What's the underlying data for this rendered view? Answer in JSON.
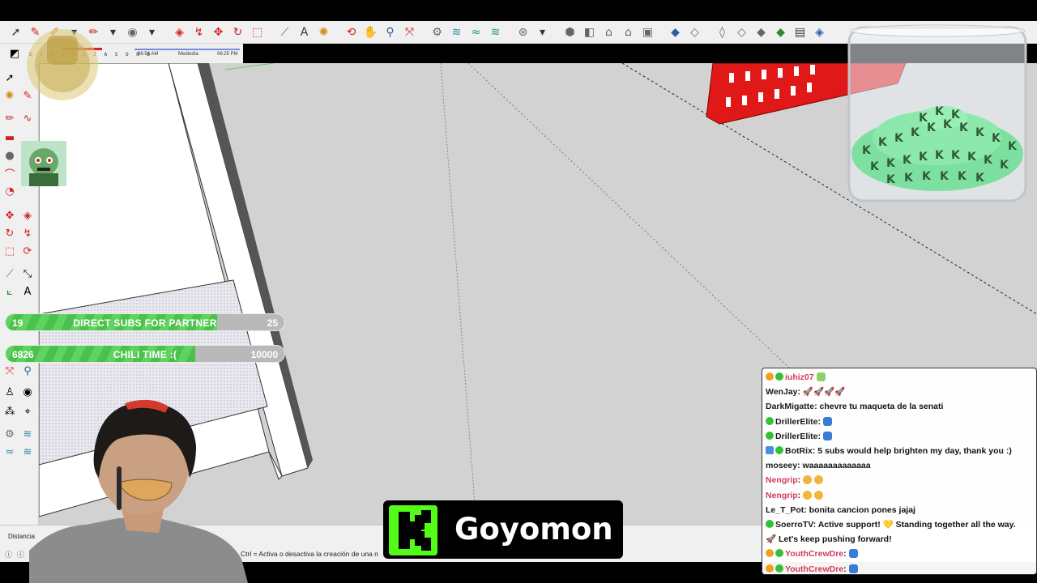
{
  "toolbar": {
    "icons": [
      "select-arrow-icon",
      "eraser-icon",
      "paint-icon",
      "dropdown-icon",
      "circle-icon",
      "dropdown-icon",
      "move-blue-icon",
      "followme-icon",
      "move-icon",
      "rotate-icon",
      "scale-icon",
      "tape-icon",
      "text-icon",
      "paint-bucket-icon",
      "orbit-icon",
      "pan-icon",
      "zoom-icon",
      "zoom-extents-icon",
      "section-icon",
      "section2-icon",
      "section3-icon",
      "section4-icon",
      "settings-icon",
      "dropdown-icon",
      "component-icon",
      "component2-icon",
      "house-icon",
      "house2-icon",
      "house3-icon",
      "box-icon",
      "box2-icon",
      "view1-icon",
      "view2-icon",
      "view3-icon",
      "view4-icon",
      "view5-icon",
      "view6-icon"
    ]
  },
  "shadow_bar": {
    "months": "E F M A M J J A S O N D",
    "time_start": "06:54 AM",
    "midday": "Mediodía",
    "time_end": "06:25 PM"
  },
  "goals": [
    {
      "current": "19",
      "title": "DIRECT SUBS FOR PARTNER",
      "target": "25",
      "progress": 0.76
    },
    {
      "current": "6826",
      "title": "CHILI TIME :(",
      "target": "10000",
      "progress": 0.68
    }
  ],
  "status": {
    "measure_label": "Distancia",
    "hint": "Ctrl = Activa o desactiva la creación de una n"
  },
  "kick": {
    "channel": "Goyomon"
  },
  "chat": [
    {
      "badges": [
        "orange",
        "green"
      ],
      "name": "iuhiz07",
      "name_color": "#d23b5a",
      "message": "",
      "emotes": [
        "g"
      ]
    },
    {
      "badges": [],
      "name": "WenJay",
      "name_color": "#1a1a1a",
      "message": ": 🚀🚀🚀🚀",
      "emotes": []
    },
    {
      "badges": [],
      "name": "DarkMigatte",
      "name_color": "#1a1a1a",
      "message": ": chevre tu maqueta de la senati",
      "emotes": []
    },
    {
      "badges": [
        "green"
      ],
      "name": "DrillerElite",
      "name_color": "#1a1a1a",
      "message": ":",
      "emotes": [
        "b"
      ]
    },
    {
      "badges": [
        "green"
      ],
      "name": "DrillerElite",
      "name_color": "#1a1a1a",
      "message": ":",
      "emotes": [
        "b"
      ]
    },
    {
      "badges": [
        "sq",
        "green"
      ],
      "name": "BotRix",
      "name_color": "#1a1a1a",
      "message": ": 5 subs would help brighten my day, thank you :)",
      "emotes": []
    },
    {
      "badges": [],
      "name": "moseey",
      "name_color": "#1a1a1a",
      "message": ": waaaaaaaaaaaaa",
      "emotes": []
    },
    {
      "badges": [],
      "name": "Nengrip",
      "name_color": "#d23b5a",
      "message": ":",
      "emotes": [
        "y",
        "y"
      ]
    },
    {
      "badges": [],
      "name": "Nengrip",
      "name_color": "#d23b5a",
      "message": ":",
      "emotes": [
        "y",
        "y"
      ]
    },
    {
      "badges": [],
      "name": "Le_T_Pot",
      "name_color": "#1a1a1a",
      "message": ": bonita cancion pones jajaj",
      "emotes": []
    },
    {
      "badges": [
        "green"
      ],
      "name": "SoerroTV",
      "name_color": "#1a1a1a",
      "message": ": Active support! 💛 Standing together all the way.",
      "emotes": []
    },
    {
      "badges": [],
      "name": "",
      "name_color": "#1a1a1a",
      "message": "🚀 Let's keep pushing forward!",
      "emotes": []
    },
    {
      "badges": [
        "orange",
        "green"
      ],
      "name": "YouthCrewDre",
      "name_color": "#d23b5a",
      "message": ":",
      "emotes": [
        "b"
      ]
    },
    {
      "badges": [
        "orange",
        "green"
      ],
      "name": "YouthCrewDre",
      "name_color": "#d23b5a",
      "message": ":",
      "emotes": [
        "b"
      ]
    }
  ],
  "colors": {
    "goal_fill": "#5fd35f",
    "kick_green": "#53fc18",
    "model_red": "#e01818",
    "viewport_bg": "#d2d2d2"
  }
}
